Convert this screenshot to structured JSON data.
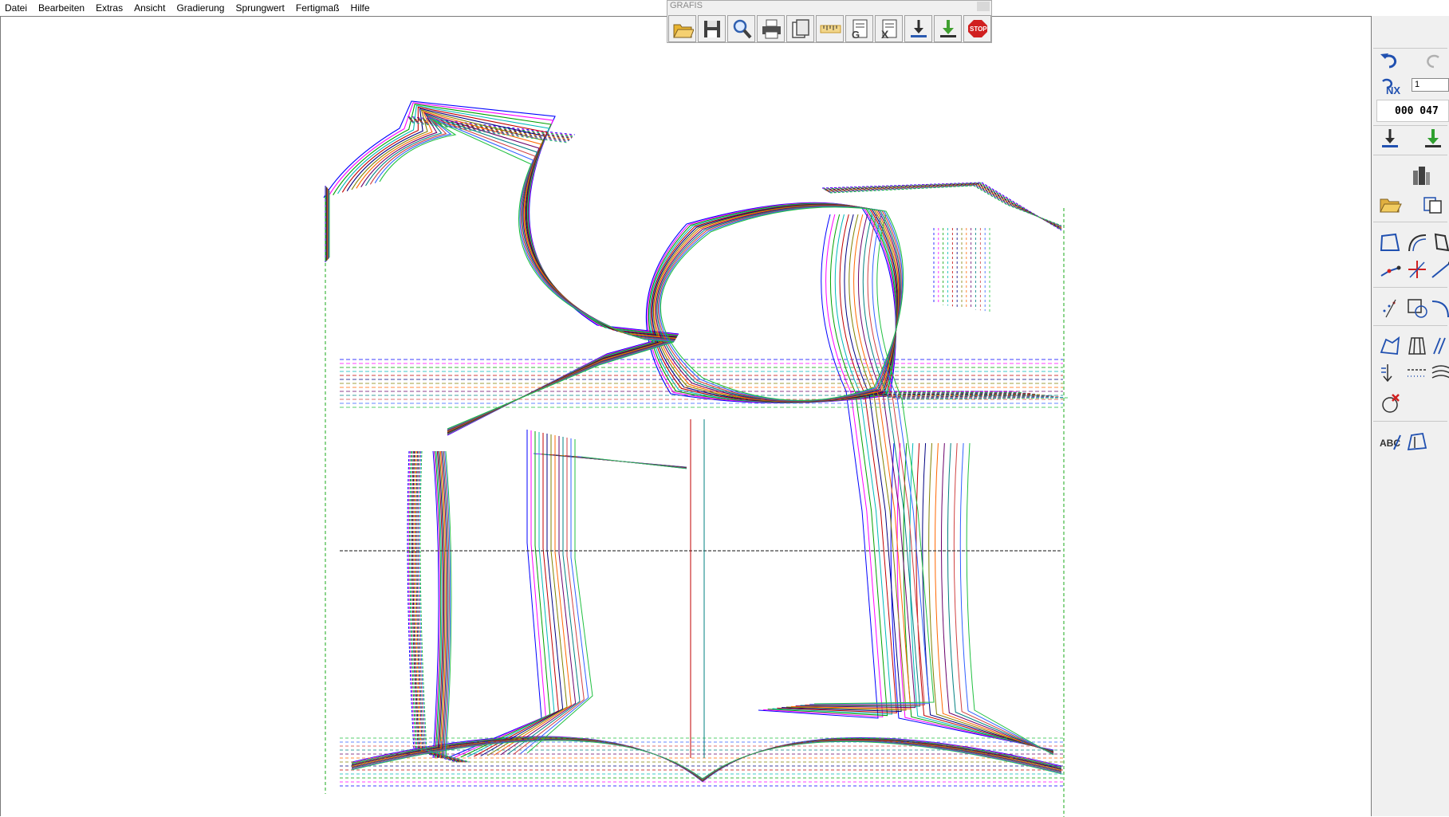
{
  "menu": [
    "Datei",
    "Bearbeiten",
    "Extras",
    "Ansicht",
    "Gradierung",
    "Sprungwert",
    "Fertigmaß",
    "Hilfe"
  ],
  "toolbar": {
    "title": "GRAFIS",
    "buttons": [
      {
        "icon": "open-folder-icon",
        "color": "#e8b430"
      },
      {
        "icon": "save-disk-icon",
        "color": "#404040"
      },
      {
        "icon": "magnifier-icon",
        "color": "#3060b0"
      },
      {
        "icon": "printer-icon",
        "color": "#505050"
      },
      {
        "icon": "pages-icon",
        "color": "#505050"
      },
      {
        "icon": "measuring-tape-icon",
        "color": "#c89a30"
      },
      {
        "icon": "export-g-icon",
        "color": "#404040"
      },
      {
        "icon": "export-x-icon",
        "color": "#404040"
      },
      {
        "icon": "download-arrow-icon",
        "color": "#2a5ab0"
      },
      {
        "icon": "download-green-icon",
        "color": "#40a030"
      },
      {
        "icon": "stop-icon",
        "color": "#d02020"
      }
    ]
  },
  "panel": {
    "nx_value": "1",
    "counter": "000 047",
    "tools": [
      "undo-icon",
      "redo-icon",
      "nx-icon",
      "arrow-down-icon",
      "arrow-down-green-icon",
      "building-icon",
      "open-folder-icon",
      "copy-piece-icon",
      "contour-icon",
      "curve-icon",
      "shape-icon",
      "line-dot-icon",
      "cross-icon",
      "line-icon",
      "points-icon",
      "square-circle-icon",
      "arc-icon",
      "fold-icon",
      "pleat-icon",
      "slant-icon",
      "arrow-mark-icon",
      "dotted-line-icon",
      "hatch-icon",
      "circle-delete-icon",
      "text-abc-icon",
      "piece-label-icon"
    ]
  },
  "colors": {
    "series": [
      "#0000ff",
      "#ff00ff",
      "#00a000",
      "#00b8b8",
      "#c00000",
      "#000080",
      "#808000",
      "#ff6600",
      "#6a006a",
      "#008080",
      "#d04040",
      "#3060ff",
      "#20c040"
    ]
  }
}
